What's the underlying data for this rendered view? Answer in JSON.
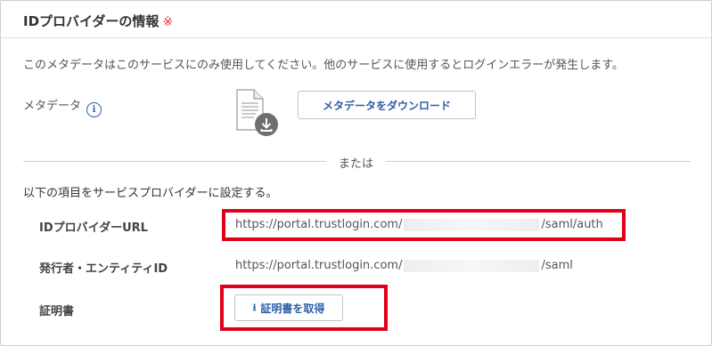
{
  "header": {
    "title": "IDプロバイダーの情報",
    "required_mark": "※"
  },
  "note": "このメタデータはこのサービスにのみ使用してください。他のサービスに使用するとログインエラーが発生します。",
  "metadata": {
    "label": "メタデータ",
    "info_icon": "i",
    "download_button": "メタデータをダウンロード"
  },
  "divider_text": "または",
  "instruction": "以下の項目をサービスプロバイダーに設定する。",
  "rows": {
    "idp_url": {
      "label": "IDプロバイダーURL",
      "prefix": "https://portal.trustlogin.com/",
      "suffix": "/saml/auth"
    },
    "issuer": {
      "label": "発行者・エンティティID",
      "prefix": "https://portal.trustlogin.com/",
      "suffix": "/saml"
    },
    "certificate": {
      "label": "証明書",
      "button": "証明書を取得"
    }
  },
  "colors": {
    "accent": "#2f5fa7",
    "highlight": "#e1001a",
    "required": "#e53935"
  }
}
